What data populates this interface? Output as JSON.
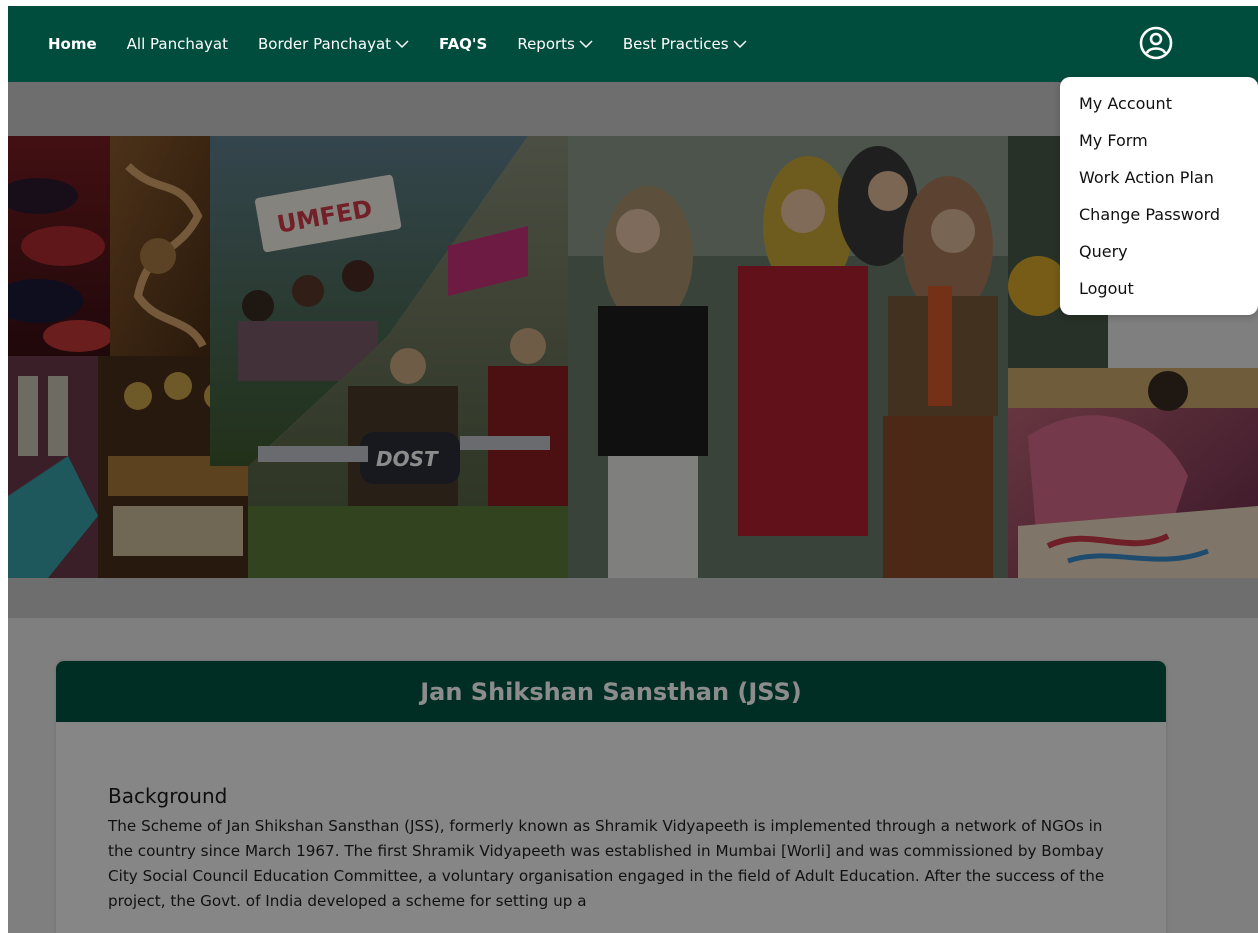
{
  "nav": {
    "items": [
      {
        "label": "Home",
        "has_dropdown": false
      },
      {
        "label": "All Panchayat",
        "has_dropdown": false
      },
      {
        "label": "Border Panchayat",
        "has_dropdown": true
      },
      {
        "label": "FAQ'S",
        "has_dropdown": false
      },
      {
        "label": "Reports",
        "has_dropdown": true
      },
      {
        "label": "Best Practices",
        "has_dropdown": true
      }
    ],
    "user_icon": "user-circle-icon"
  },
  "user_menu": {
    "items": [
      {
        "label": "My Account"
      },
      {
        "label": "My Form"
      },
      {
        "label": "Work Action Plan"
      },
      {
        "label": "Change Password"
      },
      {
        "label": "Query"
      },
      {
        "label": "Logout"
      }
    ]
  },
  "banner": {
    "sign_text": "UMFED",
    "key_text": "DOST"
  },
  "card": {
    "title": "Jan Shikshan Sansthan (JSS)",
    "section_heading": "Background",
    "section_text": "The Scheme of Jan Shikshan Sansthan (JSS), formerly known as Shramik Vidyapeeth is implemented through a network of NGOs in the country since March 1967. The first Shramik Vidyapeeth was established in Mumbai [Worli] and was commissioned by Bombay City Social Council Education Committee, a voluntary organisation engaged in the field of Adult Education. After the success of the project, the Govt. of India developed a scheme for setting up a"
  },
  "colors": {
    "nav_bg": "#004d3d",
    "card_header_bg": "#005444",
    "dropdown_bg": "#ffffff"
  }
}
